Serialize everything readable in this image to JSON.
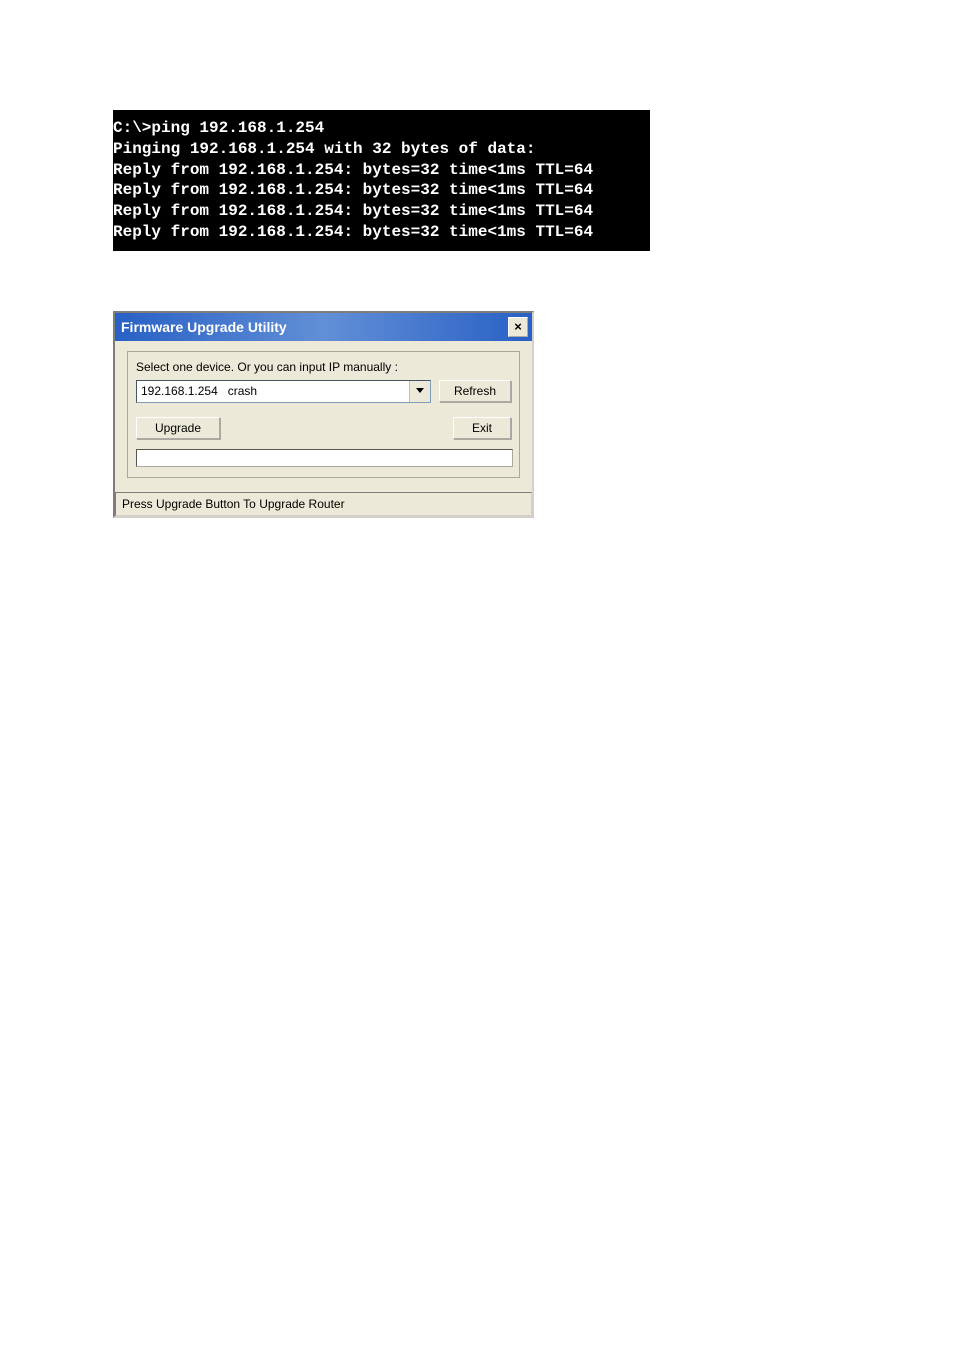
{
  "terminal": {
    "line1": "C:\\>ping 192.168.1.254",
    "line2": "",
    "line3": "Pinging 192.168.1.254 with 32 bytes of data:",
    "line4": "",
    "line5": "Reply from 192.168.1.254: bytes=32 time<1ms TTL=64",
    "line6": "Reply from 192.168.1.254: bytes=32 time<1ms TTL=64",
    "line7": "Reply from 192.168.1.254: bytes=32 time<1ms TTL=64",
    "line8": "Reply from 192.168.1.254: bytes=32 time<1ms TTL=64"
  },
  "dialog": {
    "title": "Firmware Upgrade Utility",
    "close_label": "×",
    "instruction": "Select one device. Or you can input IP manually :",
    "combo_value": "192.168.1.254   crash",
    "refresh_label": "Refresh",
    "upgrade_label": "Upgrade",
    "exit_label": "Exit",
    "status": "Press Upgrade Button To Upgrade Router"
  }
}
